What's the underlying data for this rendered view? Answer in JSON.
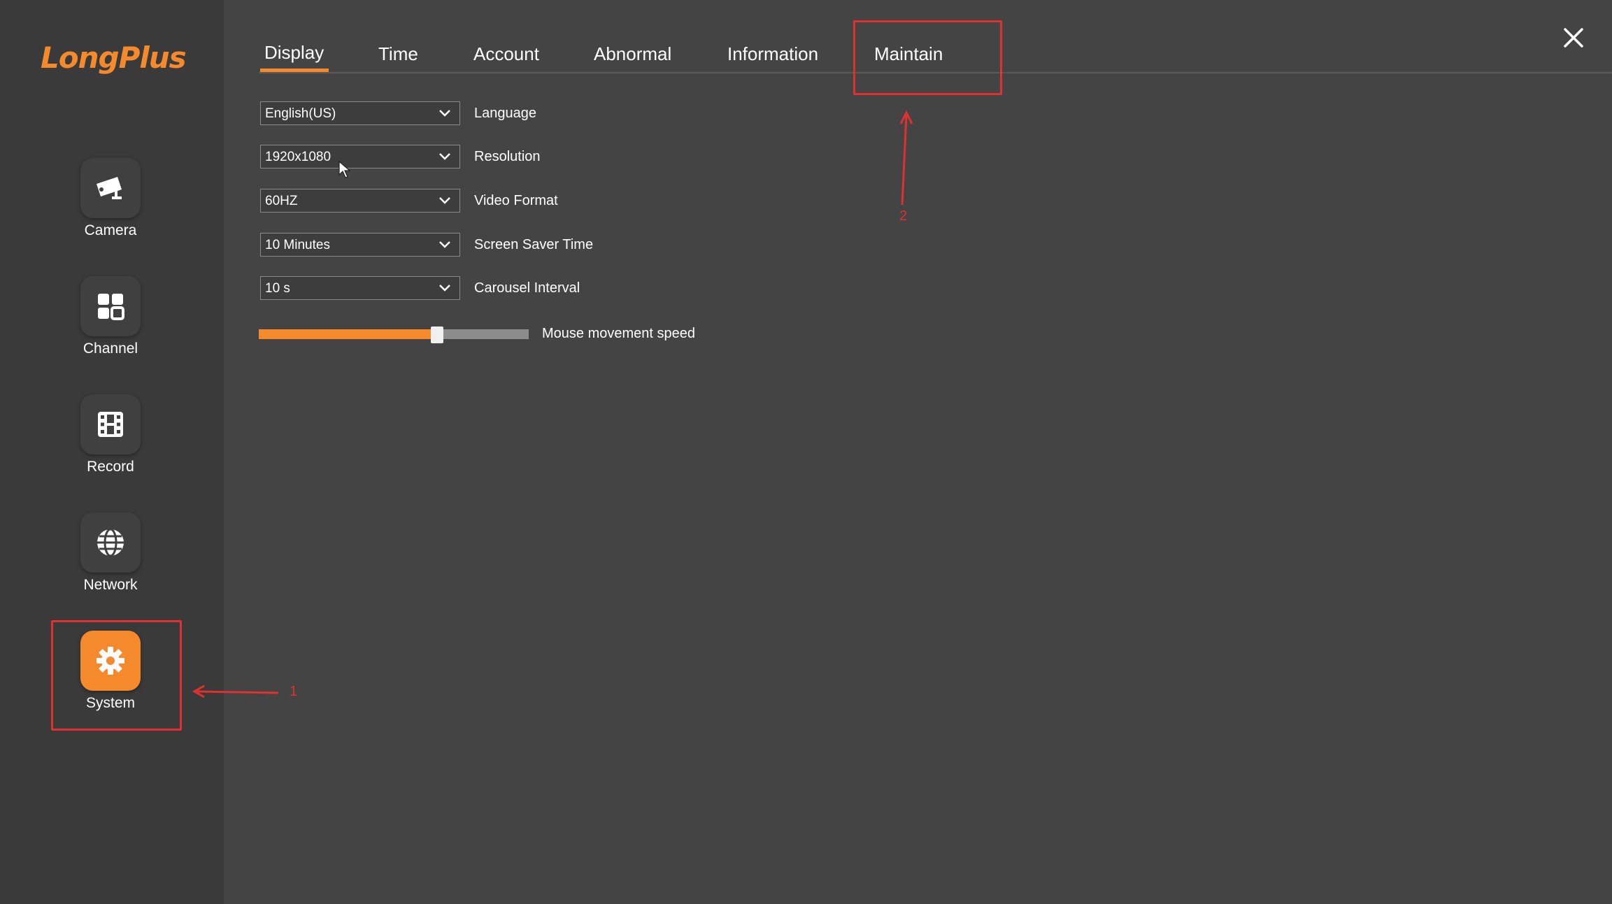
{
  "app": {
    "logo": "LongPlus"
  },
  "sidebar": {
    "items": [
      {
        "label": "Camera",
        "icon": "camera-icon"
      },
      {
        "label": "Channel",
        "icon": "grid-icon"
      },
      {
        "label": "Record",
        "icon": "film-icon"
      },
      {
        "label": "Network",
        "icon": "globe-icon"
      },
      {
        "label": "System",
        "icon": "gear-icon",
        "active": true
      }
    ]
  },
  "tabs": [
    {
      "label": "Display",
      "active": true
    },
    {
      "label": "Time"
    },
    {
      "label": "Account"
    },
    {
      "label": "Abnormal"
    },
    {
      "label": "Information"
    },
    {
      "label": "Maintain"
    }
  ],
  "settings": {
    "language": {
      "value": "English(US)",
      "label": "Language"
    },
    "resolution": {
      "value": "1920x1080",
      "label": "Resolution"
    },
    "video_format": {
      "value": "60HZ",
      "label": "Video Format"
    },
    "screen_saver": {
      "value": "10 Minutes",
      "label": "Screen Saver Time"
    },
    "carousel": {
      "value": "10 s",
      "label": "Carousel Interval"
    },
    "mouse_speed": {
      "label": "Mouse movement speed",
      "level": 0.66
    }
  },
  "annotations": {
    "step1": "1",
    "step2": "2"
  },
  "colors": {
    "accent": "#f58a2c",
    "annotation": "#e03030",
    "background": "#444444",
    "sidebar": "#3a3a3a"
  }
}
